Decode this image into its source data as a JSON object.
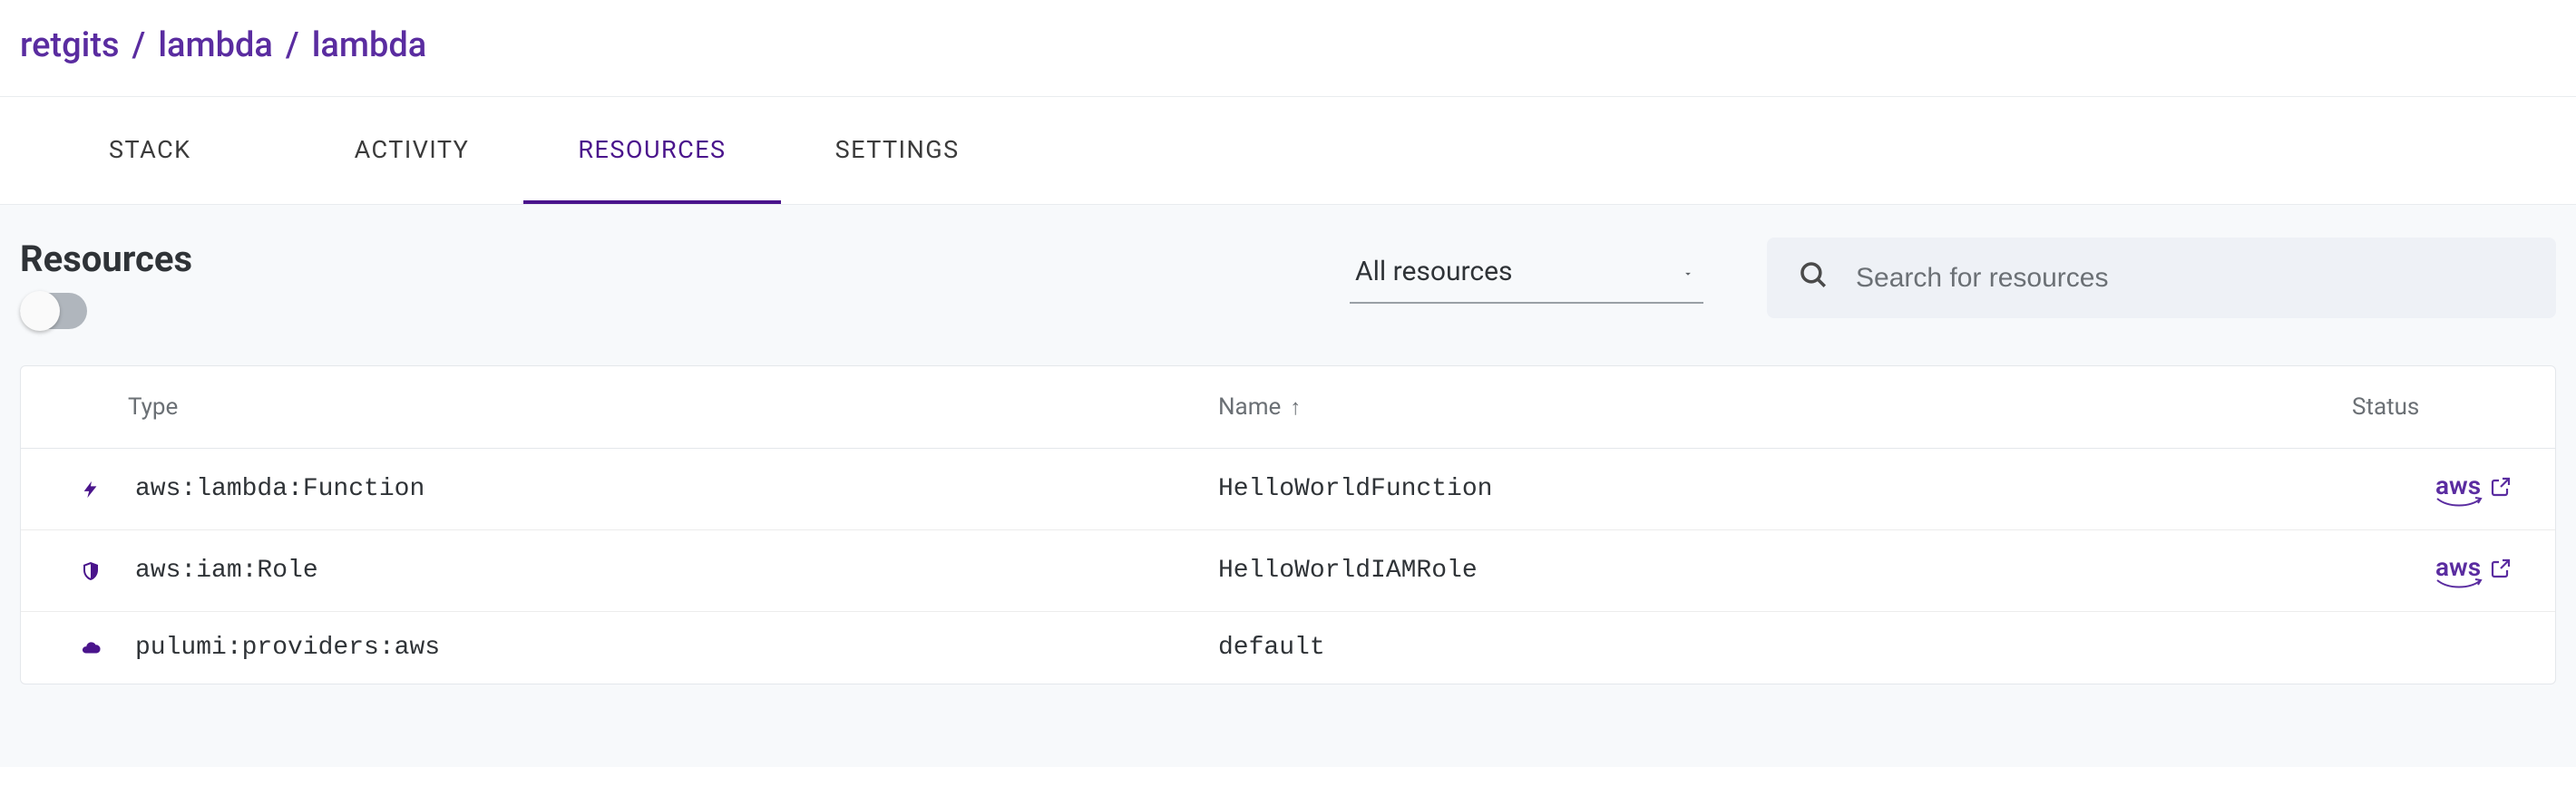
{
  "breadcrumb": {
    "org": "retgits",
    "project": "lambda",
    "stack": "lambda"
  },
  "tabs": [
    {
      "label": "STACK",
      "active": false
    },
    {
      "label": "ACTIVITY",
      "active": false
    },
    {
      "label": "RESOURCES",
      "active": true
    },
    {
      "label": "SETTINGS",
      "active": false
    }
  ],
  "section": {
    "title": "Resources",
    "toggle_on": false
  },
  "filter": {
    "selected": "All resources"
  },
  "search": {
    "placeholder": "Search for resources",
    "value": ""
  },
  "table": {
    "columns": {
      "type": "Type",
      "name": "Name",
      "status": "Status",
      "sort_column": "name",
      "sort_dir": "asc"
    },
    "rows": [
      {
        "icon": "bolt",
        "type": "aws:lambda:Function",
        "name": "HelloWorldFunction",
        "link": "aws"
      },
      {
        "icon": "shield",
        "type": "aws:iam:Role",
        "name": "HelloWorldIAMRole",
        "link": "aws"
      },
      {
        "icon": "cloud",
        "type": "pulumi:providers:aws",
        "name": "default",
        "link": null
      }
    ]
  },
  "link_labels": {
    "aws": "aws"
  }
}
